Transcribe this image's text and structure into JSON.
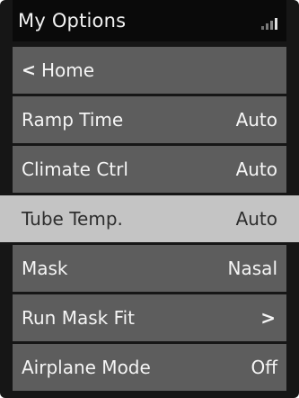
{
  "header": {
    "title": "My Options",
    "signal_icon": "signal-strength-icon"
  },
  "menu": {
    "back": {
      "label": "Home",
      "icon": "chevron-left-icon"
    },
    "items": [
      {
        "label": "Ramp Time",
        "value": "Auto"
      },
      {
        "label": "Climate Ctrl",
        "value": "Auto"
      },
      {
        "label": "Tube Temp.",
        "value": "Auto"
      },
      {
        "label": "Mask",
        "value": "Nasal"
      },
      {
        "label": "Run Mask Fit",
        "icon": "chevron-right-icon"
      },
      {
        "label": "Airplane Mode",
        "value": "Off"
      }
    ],
    "selected_label": "Tube Temp."
  },
  "colors": {
    "background": "#161616",
    "row": "#5d5d5d",
    "selected_row": "#c4c4c4",
    "text": "#f5f5f5",
    "selected_text": "#2e2e2e"
  }
}
